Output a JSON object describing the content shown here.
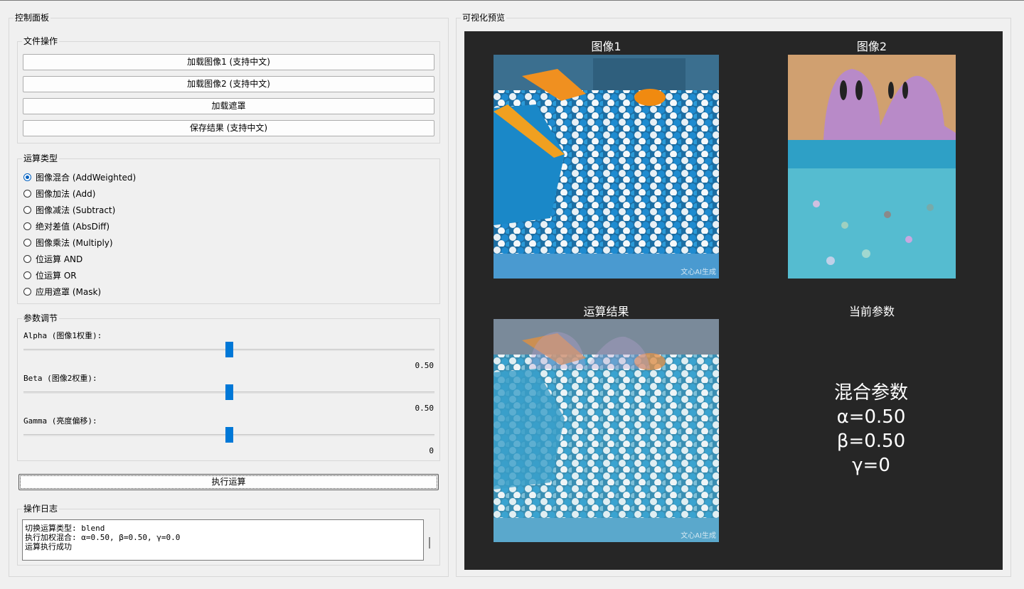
{
  "control_panel": {
    "title": "控制面板",
    "file_ops": {
      "title": "文件操作",
      "load_image1": "加载图像1 (支持中文)",
      "load_image2": "加载图像2 (支持中文)",
      "load_mask": "加载遮罩",
      "save_result": "保存结果 (支持中文)"
    },
    "op_type": {
      "title": "运算类型",
      "options": [
        {
          "label": "图像混合 (AddWeighted)",
          "checked": true
        },
        {
          "label": "图像加法 (Add)",
          "checked": false
        },
        {
          "label": "图像减法 (Subtract)",
          "checked": false
        },
        {
          "label": "绝对差值 (AbsDiff)",
          "checked": false
        },
        {
          "label": "图像乘法 (Multiply)",
          "checked": false
        },
        {
          "label": "位运算 AND",
          "checked": false
        },
        {
          "label": "位运算 OR",
          "checked": false
        },
        {
          "label": "应用遮罩 (Mask)",
          "checked": false
        }
      ]
    },
    "params": {
      "title": "参数调节",
      "alpha": {
        "label": "Alpha (图像1权重):",
        "value": "0.50",
        "level": 0.5
      },
      "beta": {
        "label": "Beta (图像2权重):",
        "value": "0.50",
        "level": 0.5
      },
      "gamma": {
        "label": "Gamma (亮度偏移):",
        "value": "0",
        "level": 0.5
      }
    },
    "execute": "执行运算",
    "log": {
      "title": "操作日志",
      "lines": [
        "切换运算类型: blend",
        "执行加权混合: α=0.50, β=0.50, γ=0.0",
        "运算执行成功"
      ]
    }
  },
  "preview": {
    "title": "可视化预览",
    "image1_title": "图像1",
    "image2_title": "图像2",
    "result_title": "运算结果",
    "params_title": "当前参数",
    "watermark": "文心AI生成",
    "params_text": [
      "混合参数",
      "α=0.50",
      "β=0.50",
      "γ=0"
    ]
  },
  "colors": {
    "accent": "#0078d7",
    "preview_bg": "#262626"
  },
  "icons": [
    "radio-icon",
    "slider-handle"
  ]
}
